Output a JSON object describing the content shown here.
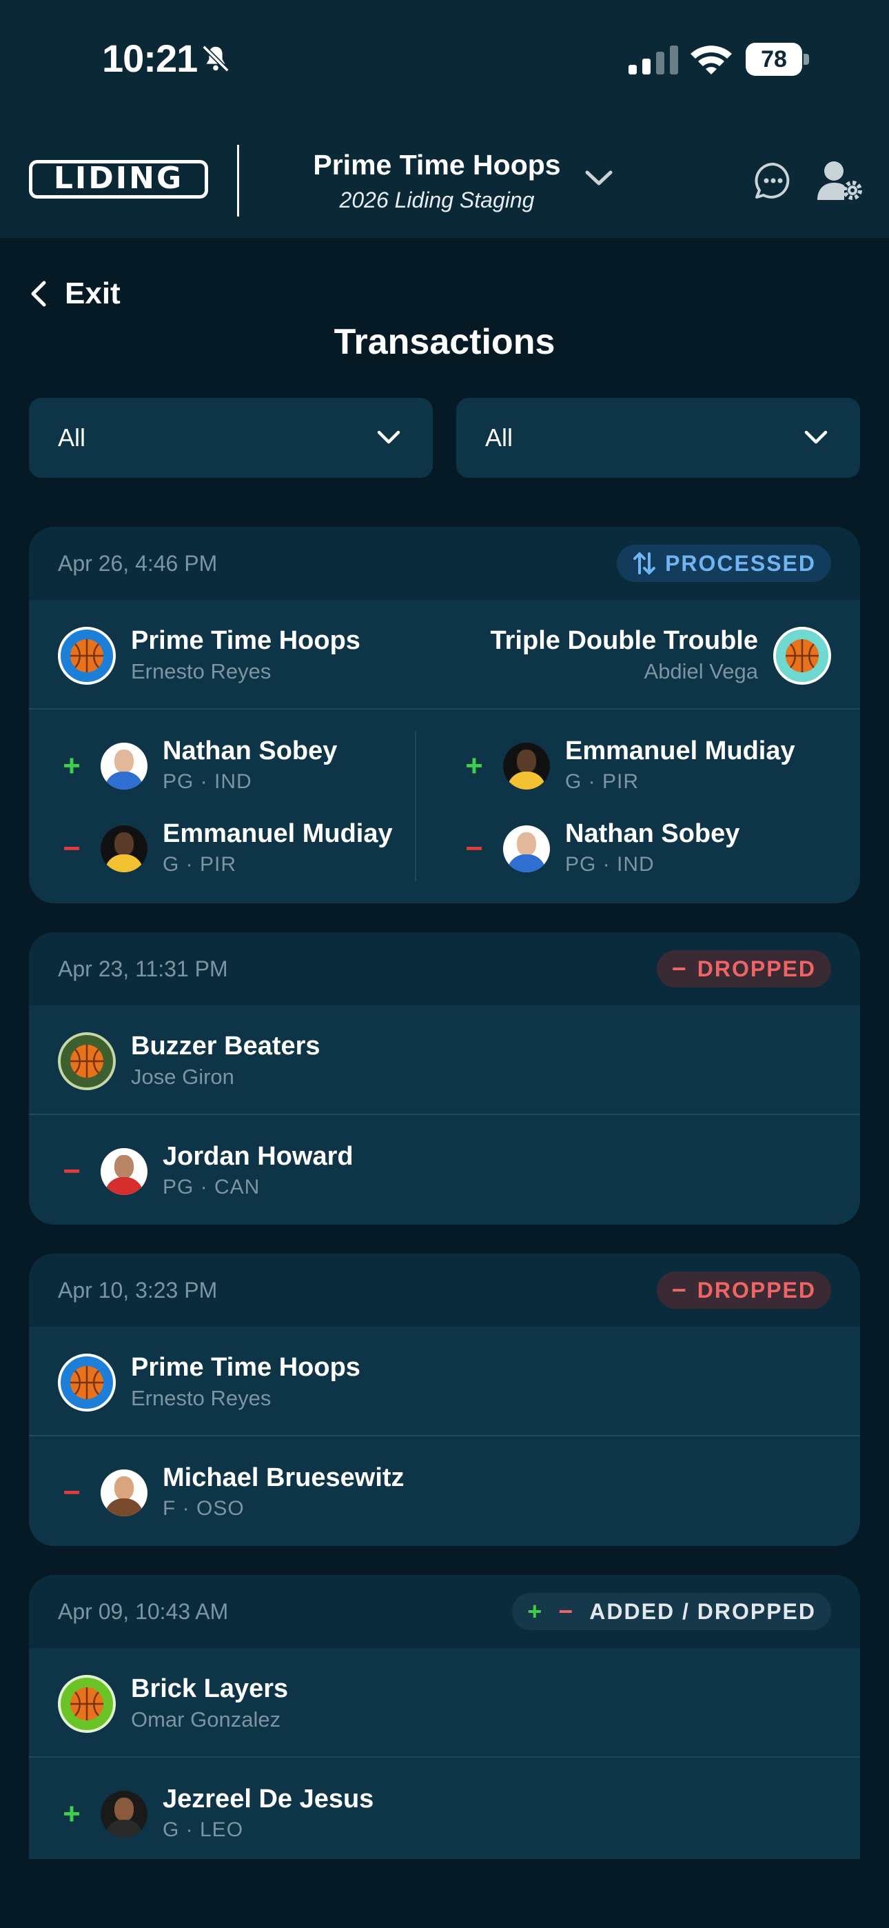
{
  "status_bar": {
    "time": "10:21",
    "battery": "78"
  },
  "header": {
    "logo": "LIDING",
    "team_name": "Prime Time Hoops",
    "league": "2026 Liding Staging"
  },
  "nav": {
    "exit_label": "Exit",
    "page_title": "Transactions"
  },
  "filters": [
    {
      "value": "All"
    },
    {
      "value": "All"
    }
  ],
  "transactions": [
    {
      "date": "Apr 26, 4:46 PM",
      "status": "PROCESSED",
      "left_team": {
        "name": "Prime Time Hoops",
        "owner": "Ernesto Reyes"
      },
      "right_team": {
        "name": "Triple Double Trouble",
        "owner": "Abdiel Vega"
      },
      "left_players": [
        {
          "sign": "+",
          "name": "Nathan Sobey",
          "pos": "PG · IND"
        },
        {
          "sign": "−",
          "name": "Emmanuel Mudiay",
          "pos": "G · PIR"
        }
      ],
      "right_players": [
        {
          "sign": "+",
          "name": "Emmanuel Mudiay",
          "pos": "G · PIR"
        },
        {
          "sign": "−",
          "name": "Nathan Sobey",
          "pos": "PG · IND"
        }
      ]
    },
    {
      "date": "Apr 23, 11:31 PM",
      "status": "DROPPED",
      "team": {
        "name": "Buzzer Beaters",
        "owner": "Jose Giron"
      },
      "players": [
        {
          "sign": "−",
          "name": "Jordan Howard",
          "pos": "PG · CAN"
        }
      ]
    },
    {
      "date": "Apr 10, 3:23 PM",
      "status": "DROPPED",
      "team": {
        "name": "Prime Time Hoops",
        "owner": "Ernesto Reyes"
      },
      "players": [
        {
          "sign": "−",
          "name": "Michael Bruesewitz",
          "pos": "F · OSO"
        }
      ]
    },
    {
      "date": "Apr 09, 10:43 AM",
      "status": "ADDED / DROPPED",
      "team": {
        "name": "Brick Layers",
        "owner": "Omar Gonzalez"
      },
      "players": [
        {
          "sign": "+",
          "name": "Jezreel De Jesus",
          "pos": "G · LEO"
        }
      ]
    }
  ],
  "colors": {
    "background": "#051a24",
    "card": "#0d3447",
    "processed": "#71b4f2",
    "dropped": "#ef6565",
    "add_green": "#3fcf4a",
    "drop_red": "#e23b3b",
    "ball_orange": "#e8731c"
  },
  "icons": [
    "bell-slash-icon",
    "signal-icon",
    "wifi-icon",
    "battery-icon",
    "chevron-down-icon",
    "chat-icon",
    "user-gear-icon",
    "chevron-left-icon",
    "swap-icon",
    "minus-icon",
    "plus-icon",
    "basketball-icon"
  ]
}
